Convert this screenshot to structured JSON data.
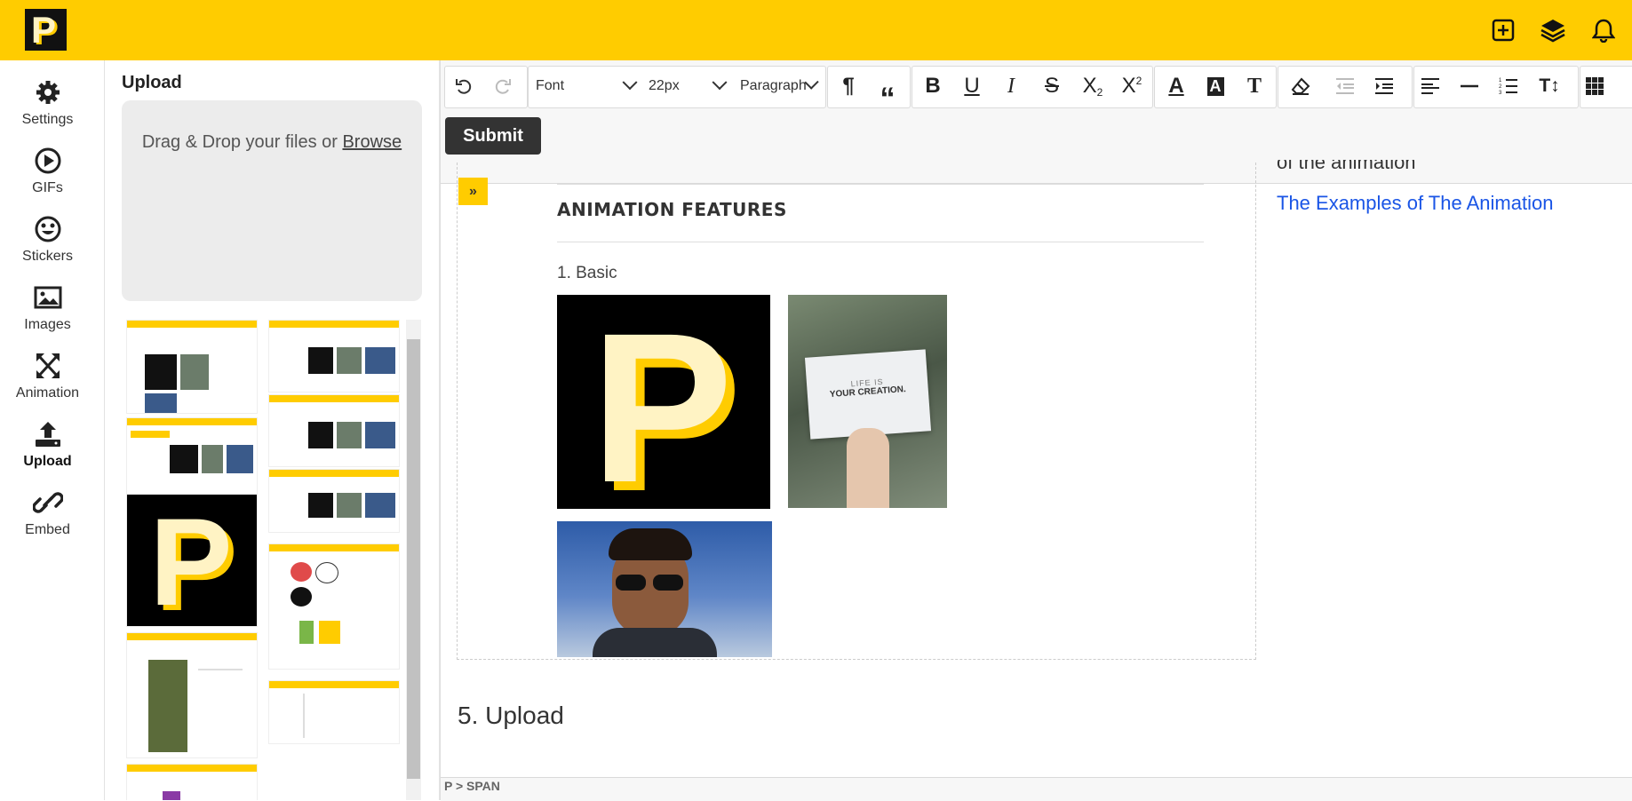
{
  "brand": {
    "logo_letter": "P",
    "accent": "#ffcc00"
  },
  "header": {
    "icons": [
      "add-square-icon",
      "layers-icon",
      "bell-icon"
    ]
  },
  "sidebar": {
    "items": [
      {
        "label": "Settings",
        "icon": "gear-icon",
        "active": false
      },
      {
        "label": "GIFs",
        "icon": "play-circle-icon",
        "active": false
      },
      {
        "label": "Stickers",
        "icon": "smiley-icon",
        "active": false
      },
      {
        "label": "Images",
        "icon": "image-icon",
        "active": false
      },
      {
        "label": "Animation",
        "icon": "expand-arrows-icon",
        "active": false
      },
      {
        "label": "Upload",
        "icon": "upload-icon",
        "active": true
      },
      {
        "label": "Embed",
        "icon": "link-icon",
        "active": false
      }
    ]
  },
  "panel": {
    "title": "Upload",
    "dropzone_text": "Drag & Drop your files or ",
    "browse_label": "Browse"
  },
  "toolbar": {
    "font_label": "Font",
    "size_label": "22px",
    "block_label": "Paragraph",
    "submit_label": "Submit"
  },
  "content": {
    "section_title": "ANIMATION FEATURES",
    "subsection": "1. Basic",
    "card_text_line1": "LIFE IS",
    "card_text_line2": "YOUR CREATION.",
    "cut_text": "of the animation",
    "examples_link": "The Examples of The Animation",
    "upload_heading": "5. Upload"
  },
  "status": {
    "path": "P > SPAN"
  }
}
